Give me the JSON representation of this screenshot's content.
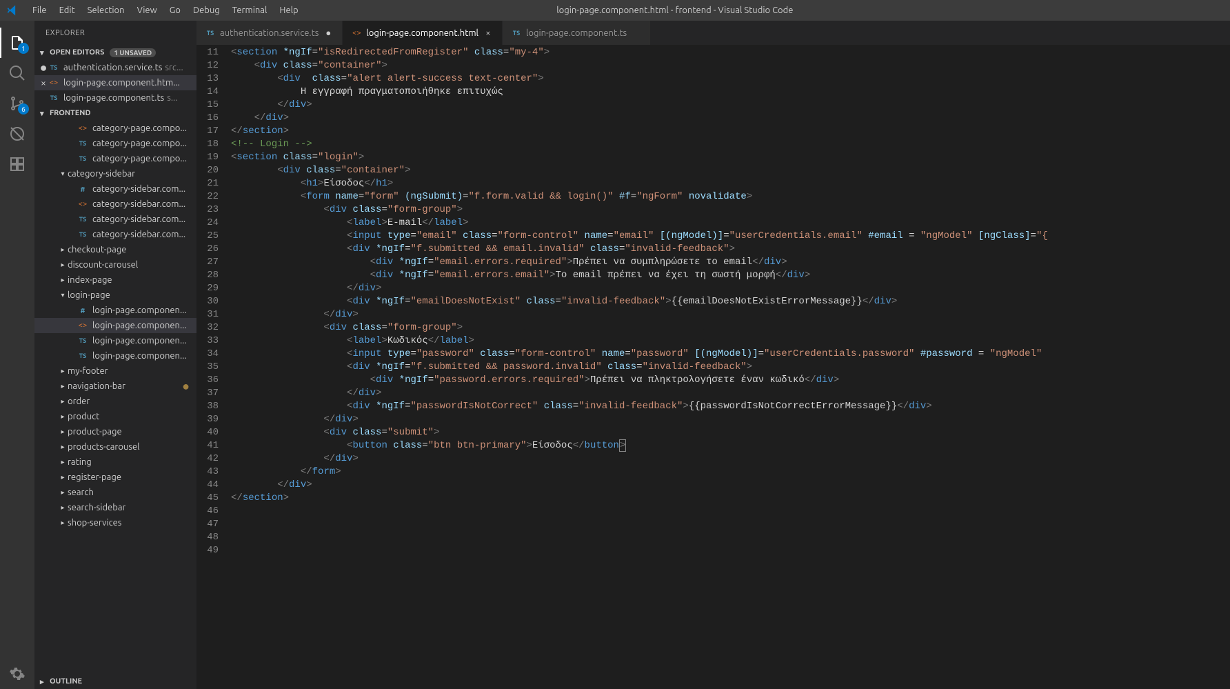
{
  "window": {
    "title": "login-page.component.html - frontend - Visual Studio Code"
  },
  "menu": [
    "File",
    "Edit",
    "Selection",
    "View",
    "Go",
    "Debug",
    "Terminal",
    "Help"
  ],
  "activitybar": {
    "explorer_badge": "1",
    "scm_badge": "6"
  },
  "sidebar": {
    "header": "EXPLORER",
    "open_editors": {
      "title": "OPEN EDITORS",
      "unsaved": "1 UNSAVED",
      "items": [
        {
          "mod": "dot",
          "icon": "ts",
          "name": "authentication.service.ts",
          "desc": "src..."
        },
        {
          "mod": "close",
          "icon": "html",
          "name": "login-page.component.htm..."
        },
        {
          "mod": "",
          "icon": "ts",
          "name": "login-page.component.ts",
          "desc": "s..."
        }
      ]
    },
    "project": {
      "title": "FRONTEND",
      "items": [
        {
          "indent": 3,
          "twisty": "",
          "icon": "html",
          "label": "category-page.compo..."
        },
        {
          "indent": 3,
          "twisty": "",
          "icon": "ts",
          "label": "category-page.compo..."
        },
        {
          "indent": 3,
          "twisty": "",
          "icon": "ts",
          "label": "category-page.compo..."
        },
        {
          "indent": 2,
          "twisty": "▾",
          "icon": "",
          "label": "category-sidebar"
        },
        {
          "indent": 3,
          "twisty": "",
          "icon": "css",
          "label": "category-sidebar.com..."
        },
        {
          "indent": 3,
          "twisty": "",
          "icon": "html",
          "label": "category-sidebar.com..."
        },
        {
          "indent": 3,
          "twisty": "",
          "icon": "ts",
          "label": "category-sidebar.com..."
        },
        {
          "indent": 3,
          "twisty": "",
          "icon": "ts",
          "label": "category-sidebar.com..."
        },
        {
          "indent": 2,
          "twisty": "▸",
          "icon": "",
          "label": "checkout-page"
        },
        {
          "indent": 2,
          "twisty": "▸",
          "icon": "",
          "label": "discount-carousel"
        },
        {
          "indent": 2,
          "twisty": "▸",
          "icon": "",
          "label": "index-page"
        },
        {
          "indent": 2,
          "twisty": "▾",
          "icon": "",
          "label": "login-page"
        },
        {
          "indent": 3,
          "twisty": "",
          "icon": "css",
          "label": "login-page.componen..."
        },
        {
          "indent": 3,
          "twisty": "",
          "icon": "html",
          "label": "login-page.componen...",
          "active": true
        },
        {
          "indent": 3,
          "twisty": "",
          "icon": "ts",
          "label": "login-page.componen..."
        },
        {
          "indent": 3,
          "twisty": "",
          "icon": "ts",
          "label": "login-page.componen..."
        },
        {
          "indent": 2,
          "twisty": "▸",
          "icon": "",
          "label": "my-footer"
        },
        {
          "indent": 2,
          "twisty": "▸",
          "icon": "",
          "label": "navigation-bar",
          "mod": true
        },
        {
          "indent": 2,
          "twisty": "▸",
          "icon": "",
          "label": "order"
        },
        {
          "indent": 2,
          "twisty": "▸",
          "icon": "",
          "label": "product"
        },
        {
          "indent": 2,
          "twisty": "▸",
          "icon": "",
          "label": "product-page"
        },
        {
          "indent": 2,
          "twisty": "▸",
          "icon": "",
          "label": "products-carousel"
        },
        {
          "indent": 2,
          "twisty": "▸",
          "icon": "",
          "label": "rating"
        },
        {
          "indent": 2,
          "twisty": "▸",
          "icon": "",
          "label": "register-page"
        },
        {
          "indent": 2,
          "twisty": "▸",
          "icon": "",
          "label": "search"
        },
        {
          "indent": 2,
          "twisty": "▸",
          "icon": "",
          "label": "search-sidebar"
        },
        {
          "indent": 2,
          "twisty": "▸",
          "icon": "",
          "label": "shop-services"
        }
      ]
    },
    "outline": "OUTLINE"
  },
  "tabs": [
    {
      "icon": "ts",
      "label": "authentication.service.ts",
      "dirty": true,
      "active": false
    },
    {
      "icon": "html",
      "label": "login-page.component.html",
      "dirty": false,
      "active": true
    },
    {
      "icon": "ts",
      "label": "login-page.component.ts",
      "dirty": false,
      "active": false
    }
  ],
  "code": {
    "first_line": 11,
    "lines": [
      "<section *ngIf=\"isRedirectedFromRegister\" class=\"my-4\">",
      "    <div class=\"container\">",
      "        <div  class=\"alert alert-success text-center\">",
      "            Η εγγραφή πραγματοποιήθηκε επιτυχώς",
      "        </div>",
      "    </div>",
      "</section>",
      "",
      "<!-- Login -->",
      "<section class=\"login\">",
      "        <div class=\"container\">",
      "            <h1>Είσοδος</h1>",
      "",
      "            <form name=\"form\" (ngSubmit)=\"f.form.valid && login()\" #f=\"ngForm\" novalidate>",
      "                <div class=\"form-group\">",
      "                    <label>E-mail</label>",
      "                    <input type=\"email\" class=\"form-control\" name=\"email\" [(ngModel)]=\"userCredentials.email\" #email = \"ngModel\" [ngClass]=\"{",
      "                    <div *ngIf=\"f.submitted && email.invalid\" class=\"invalid-feedback\">",
      "                        <div *ngIf=\"email.errors.required\">Πρέπει να συμπληρώσετε το email</div>",
      "                        <div *ngIf=\"email.errors.email\">Το email πρέπει να έχει τη σωστή μορφή</div>",
      "                    </div>",
      "                    <div *ngIf=\"emailDoesNotExist\" class=\"invalid-feedback\">{{emailDoesNotExistErrorMessage}}</div>",
      "                </div>",
      "",
      "                <div class=\"form-group\">",
      "                    <label>Κωδικός</label>",
      "                    <input type=\"password\" class=\"form-control\" name=\"password\" [(ngModel)]=\"userCredentials.password\" #password = \"ngModel\"",
      "                    <div *ngIf=\"f.submitted && password.invalid\" class=\"invalid-feedback\">",
      "                        <div *ngIf=\"password.errors.required\">Πρέπει να πληκτρολογήσετε έναν κωδικό</div>",
      "                    </div>",
      "                    <div *ngIf=\"passwordIsNotCorrect\" class=\"invalid-feedback\">{{passwordIsNotCorrectErrorMessage}}</div>",
      "                </div>",
      "",
      "                <div class=\"submit\">",
      "                    <button class=\"btn btn-primary\">Είσοδος</button>",
      "                </div>",
      "            </form>",
      "        </div>",
      "</section>"
    ]
  }
}
